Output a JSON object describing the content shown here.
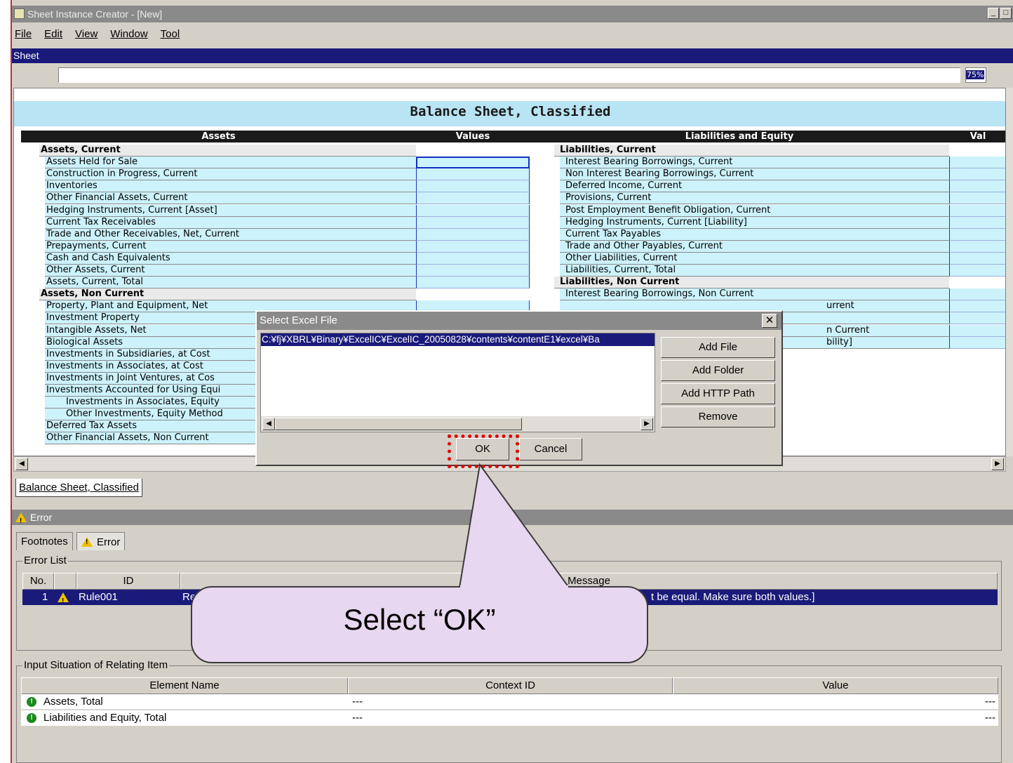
{
  "window": {
    "title": "Sheet Instance Creator - [New]",
    "min": "_",
    "max": "□"
  },
  "menu": [
    "File",
    "Edit",
    "View",
    "Window",
    "Tool"
  ],
  "sheet_panel": {
    "title": "Sheet",
    "zoom": "75%"
  },
  "balance_sheet": {
    "title": "Balance Sheet, Classified",
    "headers": {
      "assets": "Assets",
      "values": "Values",
      "liab": "Liabilities and Equity",
      "vals2": "Val"
    },
    "left_rows": [
      {
        "text": "Assets, Current",
        "section": true
      },
      {
        "text": "Assets Held for Sale"
      },
      {
        "text": "Construction in Progress, Current"
      },
      {
        "text": "Inventories"
      },
      {
        "text": "Other Financial Assets, Current"
      },
      {
        "text": "Hedging Instruments, Current [Asset]"
      },
      {
        "text": "Current Tax Receivables"
      },
      {
        "text": "Trade and Other Receivables, Net, Current"
      },
      {
        "text": "Prepayments, Current"
      },
      {
        "text": "Cash and Cash Equivalents"
      },
      {
        "text": "Other Assets, Current"
      },
      {
        "text": "Assets, Current, Total"
      },
      {
        "text": "Assets, Non Current",
        "section": true
      },
      {
        "text": "Property, Plant and Equipment, Net"
      },
      {
        "text": "Investment Property"
      },
      {
        "text": "Intangible Assets, Net"
      },
      {
        "text": "Biological Assets"
      },
      {
        "text": "Investments in Subsidiaries, at Cost"
      },
      {
        "text": "Investments in Associates, at Cost"
      },
      {
        "text": "Investments in Joint Ventures, at Cos"
      },
      {
        "text": "Investments Accounted for Using Equi"
      },
      {
        "text": "Investments in Associates, Equity",
        "indent": true
      },
      {
        "text": "Other Investments, Equity Method",
        "indent": true
      },
      {
        "text": "Deferred Tax Assets"
      },
      {
        "text": "Other Financial Assets, Non Current"
      }
    ],
    "right_rows": [
      {
        "text": "Liabilities, Current",
        "section": true
      },
      {
        "text": "Interest Bearing Borrowings, Current"
      },
      {
        "text": "Non Interest Bearing Borrowings, Current"
      },
      {
        "text": "Deferred Income, Current"
      },
      {
        "text": "Provisions, Current"
      },
      {
        "text": "Post Employment Benefit Obligation, Current"
      },
      {
        "text": "Hedging Instruments, Current [Liability]"
      },
      {
        "text": "Current Tax Payables"
      },
      {
        "text": "Trade and Other Payables, Current"
      },
      {
        "text": "Other Liabilities, Current"
      },
      {
        "text": "Liabilities, Current, Total"
      },
      {
        "text": "Liabilities, Non Current",
        "section": true
      },
      {
        "text": "Interest Bearing Borrowings, Non Current"
      },
      {
        "text": "urrent",
        "partial": true
      },
      {
        "text": "",
        "partial": true
      },
      {
        "text": "n Current",
        "partial": true
      },
      {
        "text": "bility]",
        "partial": true
      }
    ]
  },
  "sheet_tab": "Balance Sheet, Classified",
  "error_panel": {
    "title": "Error",
    "tabs": [
      "Footnotes",
      "Error"
    ],
    "error_list_label": "Error List",
    "columns": [
      "No.",
      "",
      "ID",
      "Message"
    ],
    "rows": [
      {
        "no": "1",
        "id": "Rule001",
        "msg_start": "Re",
        "msg_end": "t be equal. Make sure both values.]"
      }
    ],
    "input_label": "Input Situation of Relating Item",
    "input_columns": [
      "Element Name",
      "Context ID",
      "Value"
    ],
    "input_rows": [
      {
        "name": "Assets, Total",
        "context": "---",
        "value": "---"
      },
      {
        "name": "Liabilities and Equity, Total",
        "context": "---",
        "value": "---"
      }
    ]
  },
  "dialog": {
    "title": "Select Excel File",
    "close": "✕",
    "selected_file": "C:¥fj¥XBRL¥Binary¥ExcelIC¥ExcelIC_20050828¥contents¥contentE1¥excel¥Ba",
    "buttons": [
      "Add File",
      "Add Folder",
      "Add HTTP Path",
      "Remove"
    ],
    "ok": "OK",
    "cancel": "Cancel"
  },
  "callout": {
    "text": "Select “OK”"
  }
}
